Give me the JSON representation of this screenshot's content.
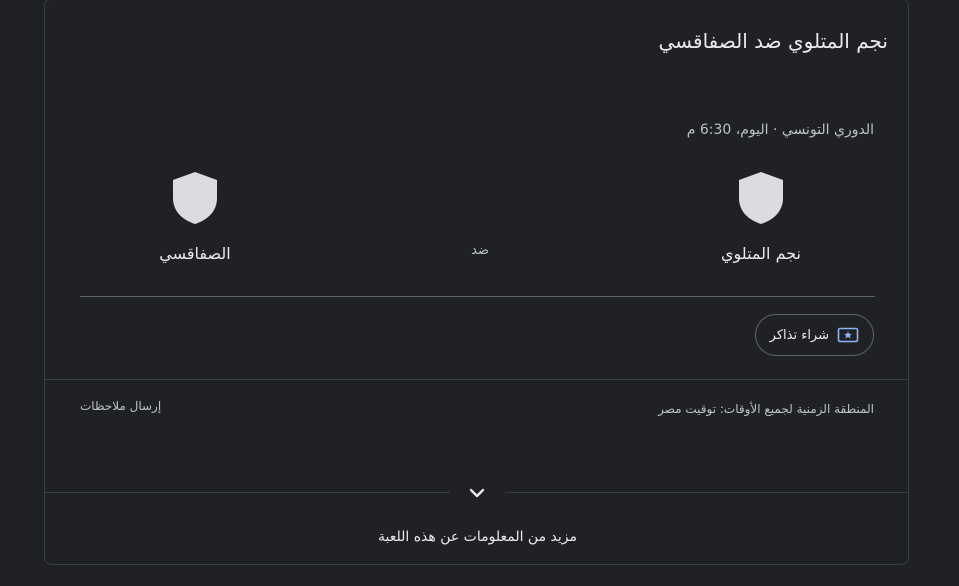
{
  "match": {
    "title": "نجم المتلوي ضد الصفاقسي",
    "meta": "الدوري التونسي · اليوم، 6:30 م",
    "vs_label": "ضد",
    "home_team": {
      "name": "نجم المتلوي",
      "icon": "shield-icon"
    },
    "away_team": {
      "name": "الصفاقسي",
      "icon": "shield-icon"
    }
  },
  "actions": {
    "tickets_label": "شراء تذاكر",
    "tickets_icon": "ticket-icon"
  },
  "footer": {
    "timezone": "المنطقة الزمنية لجميع الأوقات: توقيت مصر",
    "feedback": "إرسال ملاحظات",
    "more_info": "مزيد من المعلومات عن هذه اللعبة",
    "expand_icon": "chevron-down-icon"
  },
  "colors": {
    "background": "#202124",
    "text": "#e8eaed",
    "secondary_text": "#bdc1c6",
    "border": "#3c4043",
    "shield": "#dadce0"
  }
}
